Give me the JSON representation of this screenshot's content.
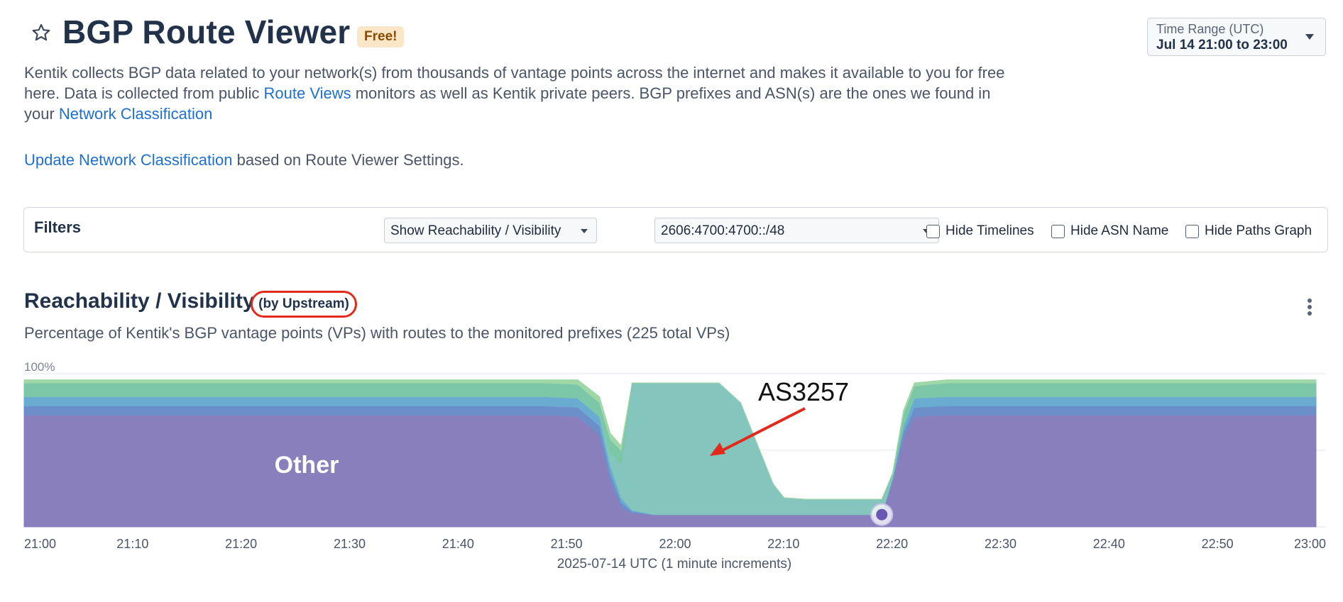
{
  "header": {
    "title": "BGP Route Viewer",
    "badge": "Free!",
    "star_icon": "star-outline-icon",
    "time_range": {
      "label": "Time Range (UTC)",
      "value": "Jul 14 21:00 to 23:00"
    }
  },
  "description": {
    "part1": "Kentik collects BGP data related to your network(s) from thousands of vantage points across the internet and makes it available to you for free here. Data is collected from public ",
    "link1": "Route Views",
    "part2": " monitors as well as Kentik private peers. BGP prefixes and ASN(s) are the ones we found in your ",
    "link2": "Network Classification"
  },
  "update": {
    "link": "Update Network Classification",
    "text": " based on Route Viewer Settings."
  },
  "filters": {
    "label": "Filters",
    "view_select": "Show Reachability / Visibility",
    "prefix_select": "2606:4700:4700::/48",
    "checkboxes": [
      {
        "label": "Hide Timelines",
        "checked": false
      },
      {
        "label": "Hide ASN Name",
        "checked": false
      },
      {
        "label": "Hide Paths Graph",
        "checked": false
      }
    ]
  },
  "section": {
    "title": "Reachability / Visibility",
    "qualifier": "(by Upstream)",
    "subtitle": "Percentage of Kentik's BGP vantage points (VPs) with routes to the monitored prefixes (225 total VPs)",
    "menu_icon": "kebab-menu-icon"
  },
  "annotations": {
    "as_label": "AS3257",
    "other_label": "Other"
  },
  "chart_data": {
    "type": "area",
    "stacked": true,
    "x_title": "2025-07-14 UTC (1 minute increments)",
    "x_ticks": [
      "21:00",
      "21:10",
      "21:20",
      "21:30",
      "21:40",
      "21:50",
      "22:00",
      "22:10",
      "22:20",
      "22:30",
      "22:40",
      "22:50",
      "23:00"
    ],
    "y_ticks": [
      "0%",
      "50%",
      "100%"
    ],
    "ylim": [
      0,
      100
    ],
    "grid": true,
    "x_minutes": [
      0,
      48,
      51,
      53,
      54,
      55,
      56,
      58,
      62,
      64,
      66,
      69,
      70,
      72,
      78,
      79,
      80,
      81,
      82,
      85,
      90,
      100,
      110,
      119
    ],
    "series": [
      {
        "name": "Other",
        "color": "#8a7fbd",
        "values": [
          73,
          73,
          72,
          60,
          30,
          13,
          9,
          8,
          8,
          8,
          8,
          8,
          8,
          8,
          8,
          8,
          30,
          58,
          72,
          73,
          73,
          73,
          73,
          73
        ]
      },
      {
        "color": "#6d8fc9",
        "values": [
          6,
          6,
          6,
          6,
          5,
          3,
          1,
          0,
          0,
          0,
          0,
          0,
          0,
          0,
          0,
          0,
          1,
          4,
          6,
          6,
          6,
          6,
          6,
          6
        ]
      },
      {
        "color": "#6aabd1",
        "values": [
          6,
          6,
          6,
          6,
          5,
          3,
          1,
          0,
          0,
          0,
          0,
          0,
          0,
          0,
          0,
          0,
          1,
          4,
          6,
          6,
          6,
          6,
          6,
          6
        ]
      },
      {
        "name": "AS3257",
        "color": "#84c6bd",
        "values": [
          0,
          0,
          0,
          0,
          8,
          22,
          82,
          86,
          86,
          86,
          73,
          20,
          11,
          10,
          10,
          10,
          2,
          0,
          0,
          0,
          0,
          0,
          0,
          0
        ]
      },
      {
        "color": "#7cc7a8",
        "values": [
          9,
          9,
          9,
          9,
          9,
          9,
          1,
          0,
          0,
          0,
          0,
          0,
          0,
          0,
          0,
          0,
          1,
          8,
          8,
          9,
          9,
          9,
          9,
          9
        ]
      },
      {
        "color": "#9fd8a6",
        "values": [
          2,
          2,
          3,
          4,
          4,
          3,
          0,
          0,
          0,
          0,
          0,
          0,
          0,
          0,
          0,
          0,
          0,
          2,
          2,
          2,
          2,
          2,
          2,
          2
        ]
      }
    ],
    "marker": {
      "x_minute": 79,
      "y": 8,
      "color": "#6a57b5"
    }
  }
}
